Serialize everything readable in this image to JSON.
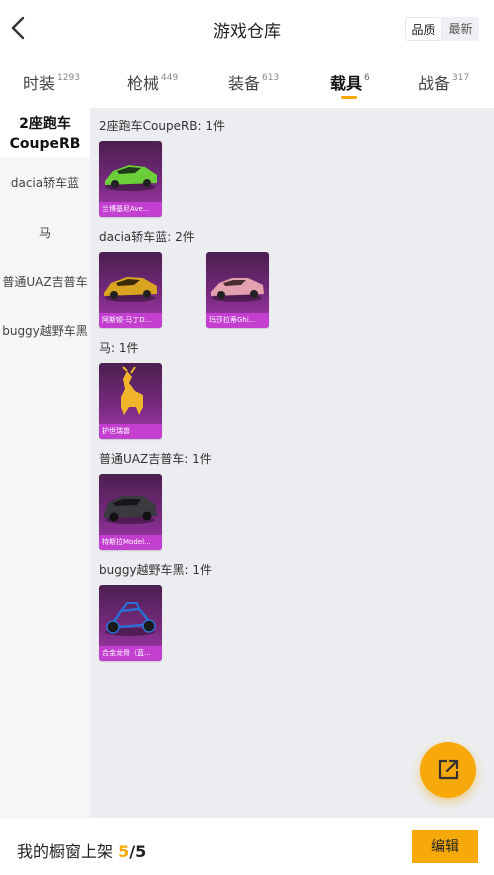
{
  "header": {
    "title": "游戏仓库",
    "sort_options": [
      "品质",
      "最新"
    ],
    "sort_selected": "品质"
  },
  "tabs": [
    {
      "label": "时装",
      "count": "1293"
    },
    {
      "label": "枪械",
      "count": "449"
    },
    {
      "label": "装备",
      "count": "613"
    },
    {
      "label": "载具",
      "count": "6",
      "active": true
    },
    {
      "label": "战备",
      "count": "317"
    }
  ],
  "sidebar": {
    "items": [
      {
        "label": "2座跑车CoupeRB",
        "lines": [
          "2座跑车",
          "CoupeRB"
        ]
      },
      {
        "label": "dacia轿车蓝"
      },
      {
        "label": "马"
      },
      {
        "label": "普通UAZ吉普车"
      },
      {
        "label": "buggy越野车黑"
      }
    ]
  },
  "groups": [
    {
      "title": "2座跑车CoupeRB: 1件",
      "items": [
        {
          "name": "兰博基尼Ave...",
          "icon": "green-supercar"
        }
      ]
    },
    {
      "title": "dacia轿车蓝: 2件",
      "items": [
        {
          "name": "阿斯顿·马丁D...",
          "icon": "gold-sportscar"
        },
        {
          "name": "玛莎拉蒂Ghi...",
          "icon": "pink-sedan"
        }
      ]
    },
    {
      "title": "马: 1件",
      "items": [
        {
          "name": "护世瑞兽",
          "icon": "golden-beast"
        }
      ]
    },
    {
      "title": "普通UAZ吉普车: 1件",
      "items": [
        {
          "name": "特斯拉Model...",
          "icon": "dark-suv"
        }
      ]
    },
    {
      "title": "buggy越野车黑: 1件",
      "items": [
        {
          "name": "合金龙骨（蓝...",
          "icon": "blue-buggy"
        }
      ]
    }
  ],
  "fab": {
    "icon": "share-icon"
  },
  "bottom": {
    "shelf_label": "我的橱窗上架",
    "shelf_count": "5",
    "shelf_sep": "/",
    "shelf_total": "5",
    "edit_label": "编辑"
  },
  "colors": {
    "accent": "#f7a90a",
    "card_bg": "#7b2b82",
    "card_caption": "#c23fd0"
  }
}
